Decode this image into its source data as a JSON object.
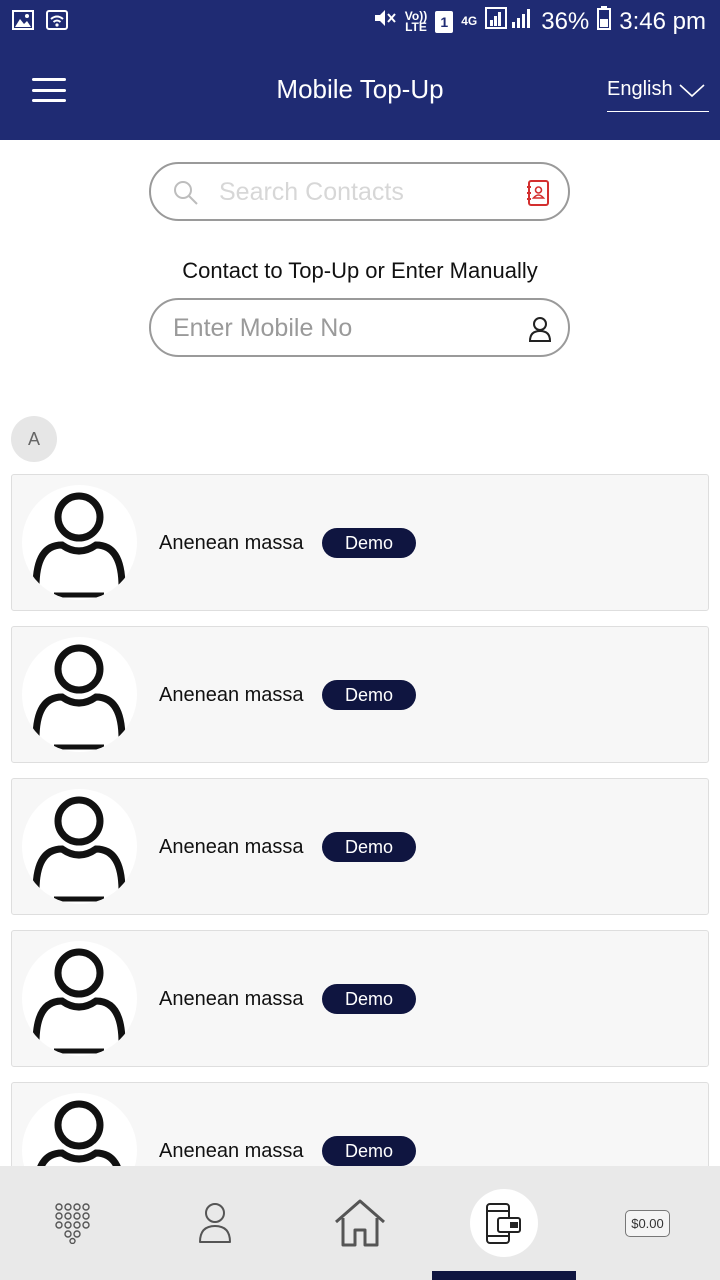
{
  "status_bar": {
    "volte_top": "Vo))",
    "volte_bottom": "LTE",
    "sim": "1",
    "network": "4G",
    "battery": "36%",
    "time": "3:46 pm"
  },
  "header": {
    "title": "Mobile Top-Up",
    "language": "English"
  },
  "search": {
    "placeholder": "Search Contacts"
  },
  "instruction": "Contact to Top-Up or Enter Manually",
  "mobile_input": {
    "placeholder": "Enter Mobile No"
  },
  "section_letter": "A",
  "contacts": [
    {
      "name": "Anenean massa",
      "tag": "Demo"
    },
    {
      "name": "Anenean massa",
      "tag": "Demo"
    },
    {
      "name": "Anenean massa",
      "tag": "Demo"
    },
    {
      "name": "Anenean massa",
      "tag": "Demo"
    },
    {
      "name": "Anenean massa",
      "tag": "Demo"
    }
  ],
  "bottom_nav": {
    "items": [
      "dialpad-icon",
      "profile-icon",
      "home-icon",
      "mobile-wallet-icon",
      "balance"
    ],
    "active": "mobile-wallet-icon",
    "balance": "$0.00"
  },
  "colors": {
    "primary": "#1f2b73",
    "tag": "#0f1540",
    "card": "#f7f7f7",
    "nav": "#e9e9e9"
  }
}
